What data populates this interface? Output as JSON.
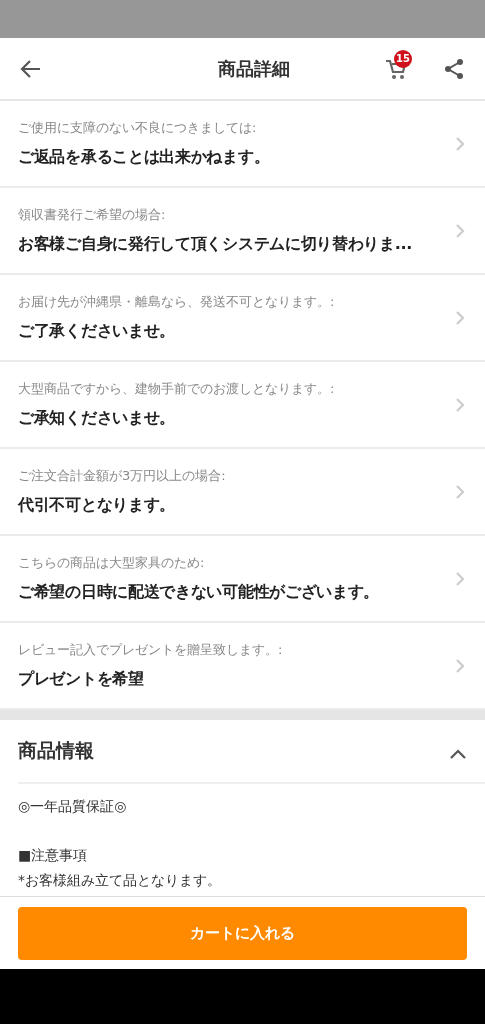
{
  "header": {
    "title": "商品詳細",
    "cart_count": "15"
  },
  "notes": [
    {
      "label": "ご使用に支障のない不良につきましては:",
      "value": "ご返品を承ることは出来かねます。"
    },
    {
      "label": "領収書発行ご希望の場合:",
      "value": "お客様ご自身に発行して頂くシステムに切り替わりま..."
    },
    {
      "label": "お届け先が沖縄県・離島なら、発送不可となります。:",
      "value": "ご了承くださいませ。"
    },
    {
      "label": "大型商品ですから、建物手前でのお渡しとなります。:",
      "value": "ご承知くださいませ。"
    },
    {
      "label": "ご注文合計金額が3万円以上の場合:",
      "value": "代引不可となります。"
    },
    {
      "label": "こちらの商品は大型家具のため:",
      "value": "ご希望の日時に配送できない可能性がございます。"
    },
    {
      "label": "レビュー記入でプレゼントを贈呈致します。:",
      "value": "プレゼントを希望"
    }
  ],
  "product_info": {
    "title": "商品情報",
    "expanded": true,
    "paragraphs": [
      [
        "◎一年品質保証◎"
      ],
      [
        "■注意事項",
        "*お客様組み立て品となります。"
      ]
    ]
  },
  "add_to_cart": "カートに入れる"
}
